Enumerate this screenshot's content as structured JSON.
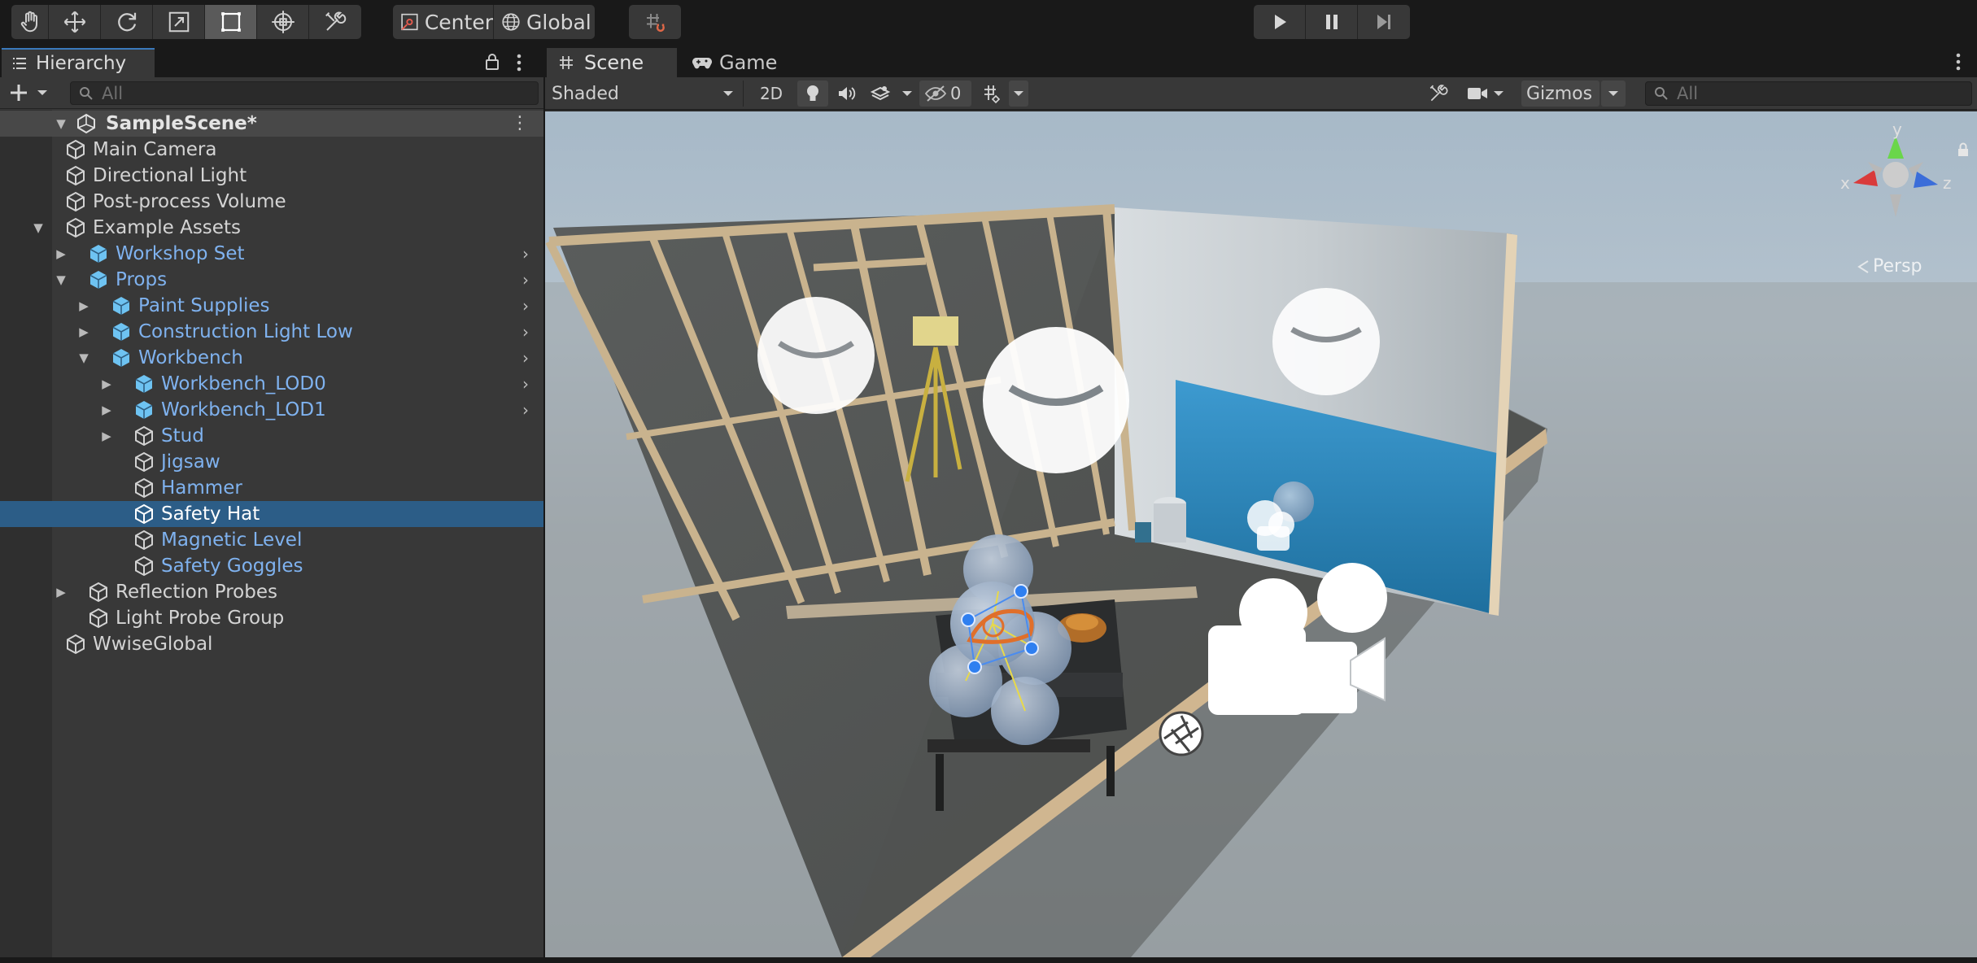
{
  "toolbar": {
    "tools": [
      "hand-tool",
      "move-tool",
      "rotate-tool",
      "scale-tool",
      "rect-tool",
      "transform-tool",
      "custom-tool"
    ],
    "pivot_label": "Center",
    "space_label": "Global",
    "play_controls": [
      "play",
      "pause",
      "step"
    ]
  },
  "hierarchy": {
    "tab_label": "Hierarchy",
    "search_placeholder": "All",
    "scene_name": "SampleScene*",
    "items": [
      {
        "label": "Main Camera"
      },
      {
        "label": "Directional Light"
      },
      {
        "label": "Post-process Volume"
      },
      {
        "label": "Example Assets"
      },
      {
        "label": "Workshop Set"
      },
      {
        "label": "Props"
      },
      {
        "label": "Paint Supplies"
      },
      {
        "label": "Construction Light Low"
      },
      {
        "label": "Workbench"
      },
      {
        "label": "Workbench_LOD0"
      },
      {
        "label": "Workbench_LOD1"
      },
      {
        "label": "Stud"
      },
      {
        "label": "Jigsaw"
      },
      {
        "label": "Hammer"
      },
      {
        "label": "Safety Hat"
      },
      {
        "label": "Magnetic Level"
      },
      {
        "label": "Safety Goggles"
      },
      {
        "label": "Reflection Probes"
      },
      {
        "label": "Light Probe Group"
      },
      {
        "label": "WwiseGlobal"
      }
    ]
  },
  "scene_view": {
    "tabs": [
      {
        "label": "Scene"
      },
      {
        "label": "Game"
      }
    ],
    "shading_mode": "Shaded",
    "mode_2d_label": "2D",
    "hidden_count": "0",
    "gizmos_label": "Gizmos",
    "search_placeholder": "All",
    "projection_label": "Persp",
    "axis_labels": {
      "y": "y",
      "x": "x",
      "z": "z"
    }
  },
  "colors": {
    "selection": "#2c5d87",
    "prefab_text": "#7fb2ef",
    "active_tab_accent": "#3a79bb"
  }
}
